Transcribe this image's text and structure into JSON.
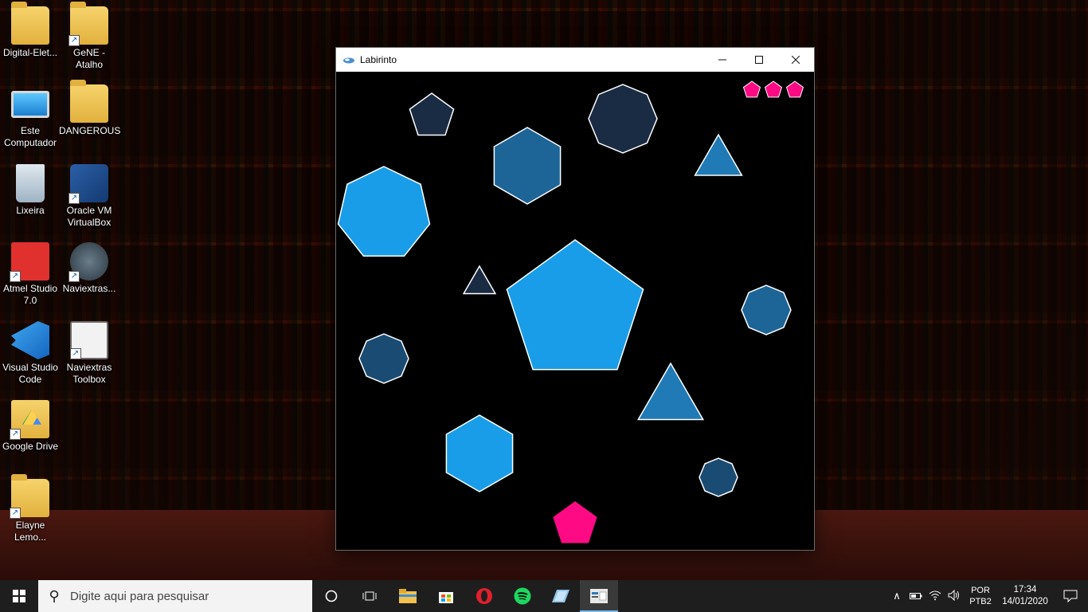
{
  "window": {
    "title": "Labirinto",
    "controls": [
      "minimize",
      "maximize",
      "close"
    ]
  },
  "desktop": {
    "icons": [
      {
        "label": "Digital-Elet...",
        "icon": "folder-icon",
        "shortcut": false
      },
      {
        "label": "GeNE - Atalho",
        "icon": "document-folder-icon",
        "shortcut": true
      },
      {
        "label": "Este Computador",
        "icon": "computer-icon",
        "shortcut": false
      },
      {
        "label": "DANGEROUS",
        "icon": "folder-icon",
        "shortcut": false
      },
      {
        "label": "Lixeira",
        "icon": "recycle-bin-icon",
        "shortcut": false
      },
      {
        "label": "Oracle VM VirtualBox",
        "icon": "virtualbox-icon",
        "shortcut": true
      },
      {
        "label": "Atmel Studio 7.0",
        "icon": "atmel-studio-icon",
        "shortcut": true
      },
      {
        "label": "Naviextras...",
        "icon": "naviextras-icon",
        "shortcut": true
      },
      {
        "label": "Visual Studio Code",
        "icon": "vscode-icon",
        "shortcut": true
      },
      {
        "label": "Naviextras Toolbox",
        "icon": "naviextras-toolbox-icon",
        "shortcut": true
      },
      {
        "label": "Google Drive",
        "icon": "google-drive-icon",
        "shortcut": true
      },
      {
        "label": "Elayne Lemo...",
        "icon": "folder-icon",
        "shortcut": true
      }
    ]
  },
  "game": {
    "lives": 3,
    "colors": {
      "background": "#000000",
      "player": "#ff0a85",
      "light_blue": "#1a9de8",
      "mid_blue": "#1f7ab5",
      "steel_blue": "#1d6597",
      "dark_blue": "#1a4b73",
      "navy": "#1a2b44",
      "outline": "#ffffff"
    },
    "player_shape": "pentagon",
    "obstacle_shapes": [
      "pentagon",
      "octagon",
      "hexagon",
      "triangle",
      "heptagon",
      "triangle",
      "pentagon",
      "octagon",
      "octagon",
      "triangle",
      "hexagon",
      "octagon"
    ]
  },
  "taskbar": {
    "search_placeholder": "Digite aqui para pesquisar",
    "pinned": [
      "cortana-icon",
      "task-view-icon",
      "file-explorer-icon",
      "store-icon",
      "opera-icon",
      "spotify-icon",
      "app-icon",
      "labirinto-app-icon"
    ],
    "language_line1": "POR",
    "language_line2": "PTB2",
    "time": "17:34",
    "date": "14/01/2020"
  }
}
